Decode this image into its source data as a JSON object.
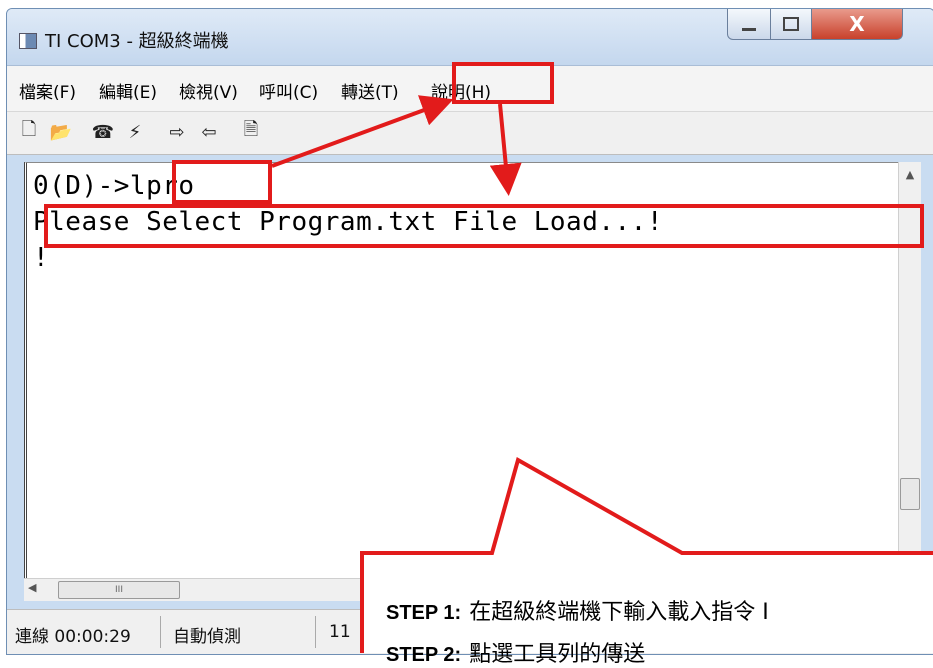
{
  "window": {
    "title": "TI COM3 - 超級終端機",
    "close_glyph": "X"
  },
  "menu": [
    "檔案(F)",
    "編輯(E)",
    "檢視(V)",
    "呼叫(C)",
    "轉送(T)",
    "說明(H)"
  ],
  "toolbar": {
    "icons": [
      "new-icon",
      "open-icon",
      "call-icon",
      "disconnect-icon",
      "send-icon",
      "receive-icon",
      "properties-icon"
    ],
    "glyphs": [
      "🗋",
      "📂",
      "☎",
      "⚡",
      "⇨",
      "⇦",
      "🗎"
    ]
  },
  "terminal": {
    "lines": [
      "0(D)->lpro",
      "Please Select Program.txt File Load...!",
      "!"
    ]
  },
  "scroll": {
    "h_thumb": "III"
  },
  "status": {
    "connected": "連線 00:00:29",
    "detect": "自動偵測",
    "partial": "11"
  },
  "callout": {
    "step1_label": "STEP 1:",
    "step1_text": "在超級終端機下輸入載入指令",
    "step1_tail": "I",
    "step2_label": "STEP 2:",
    "step2_text": "點選工具列的傳送"
  },
  "colors": {
    "annotation": "#e21b1b",
    "title_bg": "#c9dcf1"
  }
}
